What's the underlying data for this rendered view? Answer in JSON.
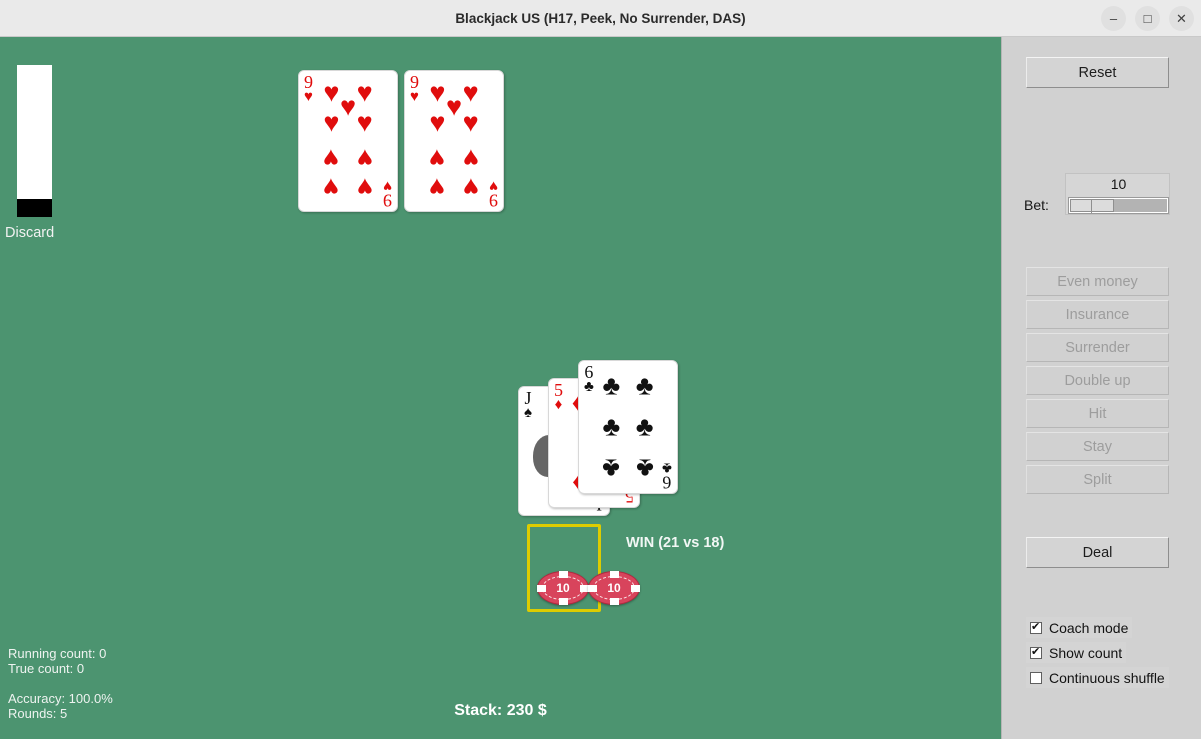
{
  "window": {
    "title": "Blackjack US (H17, Peek, No Surrender, DAS)",
    "minimize_label": "–",
    "maximize_label": "□",
    "close_label": "✕"
  },
  "table": {
    "discard_label": "Discard",
    "result_text": "WIN (21 vs 18)",
    "stack_text": "Stack: 230 $",
    "felt_color": "#4c9470",
    "bet_box_color": "#ddcc00",
    "stats": {
      "running_count": "Running count: 0",
      "true_count": "True count: 0",
      "accuracy": "Accuracy: 100.0%",
      "rounds": "Rounds: 5"
    },
    "dealer_hand": [
      {
        "rank": "9",
        "suit": "♥",
        "color": "red"
      },
      {
        "rank": "9",
        "suit": "♥",
        "color": "red"
      }
    ],
    "player_hand": [
      {
        "rank": "J",
        "suit": "♠",
        "color": "black"
      },
      {
        "rank": "5",
        "suit": "♦",
        "color": "red"
      },
      {
        "rank": "6",
        "suit": "♣",
        "color": "black"
      }
    ],
    "chips": [
      {
        "value": "10",
        "color": "#d8445c"
      },
      {
        "value": "10",
        "color": "#d8445c"
      }
    ]
  },
  "sidebar": {
    "reset_label": "Reset",
    "bet_label": "Bet:",
    "bet_value": "10",
    "deal_label": "Deal",
    "actions": [
      {
        "label": "Even money",
        "enabled": false
      },
      {
        "label": "Insurance",
        "enabled": false
      },
      {
        "label": "Surrender",
        "enabled": false
      },
      {
        "label": "Double up",
        "enabled": false
      },
      {
        "label": "Hit",
        "enabled": false
      },
      {
        "label": "Stay",
        "enabled": false
      },
      {
        "label": "Split",
        "enabled": false
      }
    ],
    "checkboxes": [
      {
        "label": "Coach mode",
        "checked": true
      },
      {
        "label": "Show count",
        "checked": true
      },
      {
        "label": "Continuous shuffle",
        "checked": false
      }
    ]
  }
}
